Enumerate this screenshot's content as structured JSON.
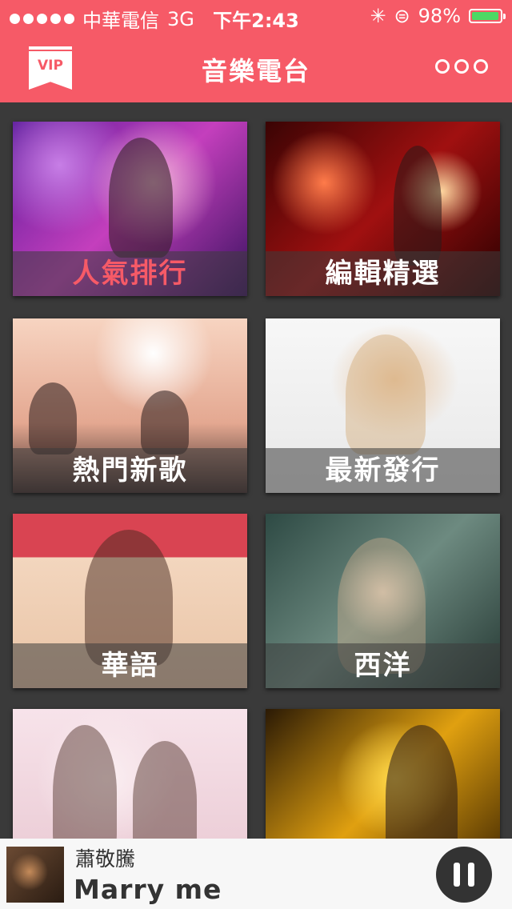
{
  "status": {
    "carrier": "中華電信",
    "network": "3G",
    "time": "下午2:43",
    "battery": "98%",
    "battery_level": 0.98
  },
  "nav": {
    "vip": "VIP",
    "title": "音樂電台"
  },
  "categories": [
    {
      "label": "人氣排行"
    },
    {
      "label": "編輯精選"
    },
    {
      "label": "熱門新歌"
    },
    {
      "label": "最新發行"
    },
    {
      "label": "華語"
    },
    {
      "label": "西洋"
    }
  ],
  "player": {
    "artist": "蕭敬騰",
    "song": "Marry me"
  },
  "colors": {
    "accent": "#f65a67",
    "highlight_label": "#f65a67",
    "battery": "#4cd964"
  }
}
